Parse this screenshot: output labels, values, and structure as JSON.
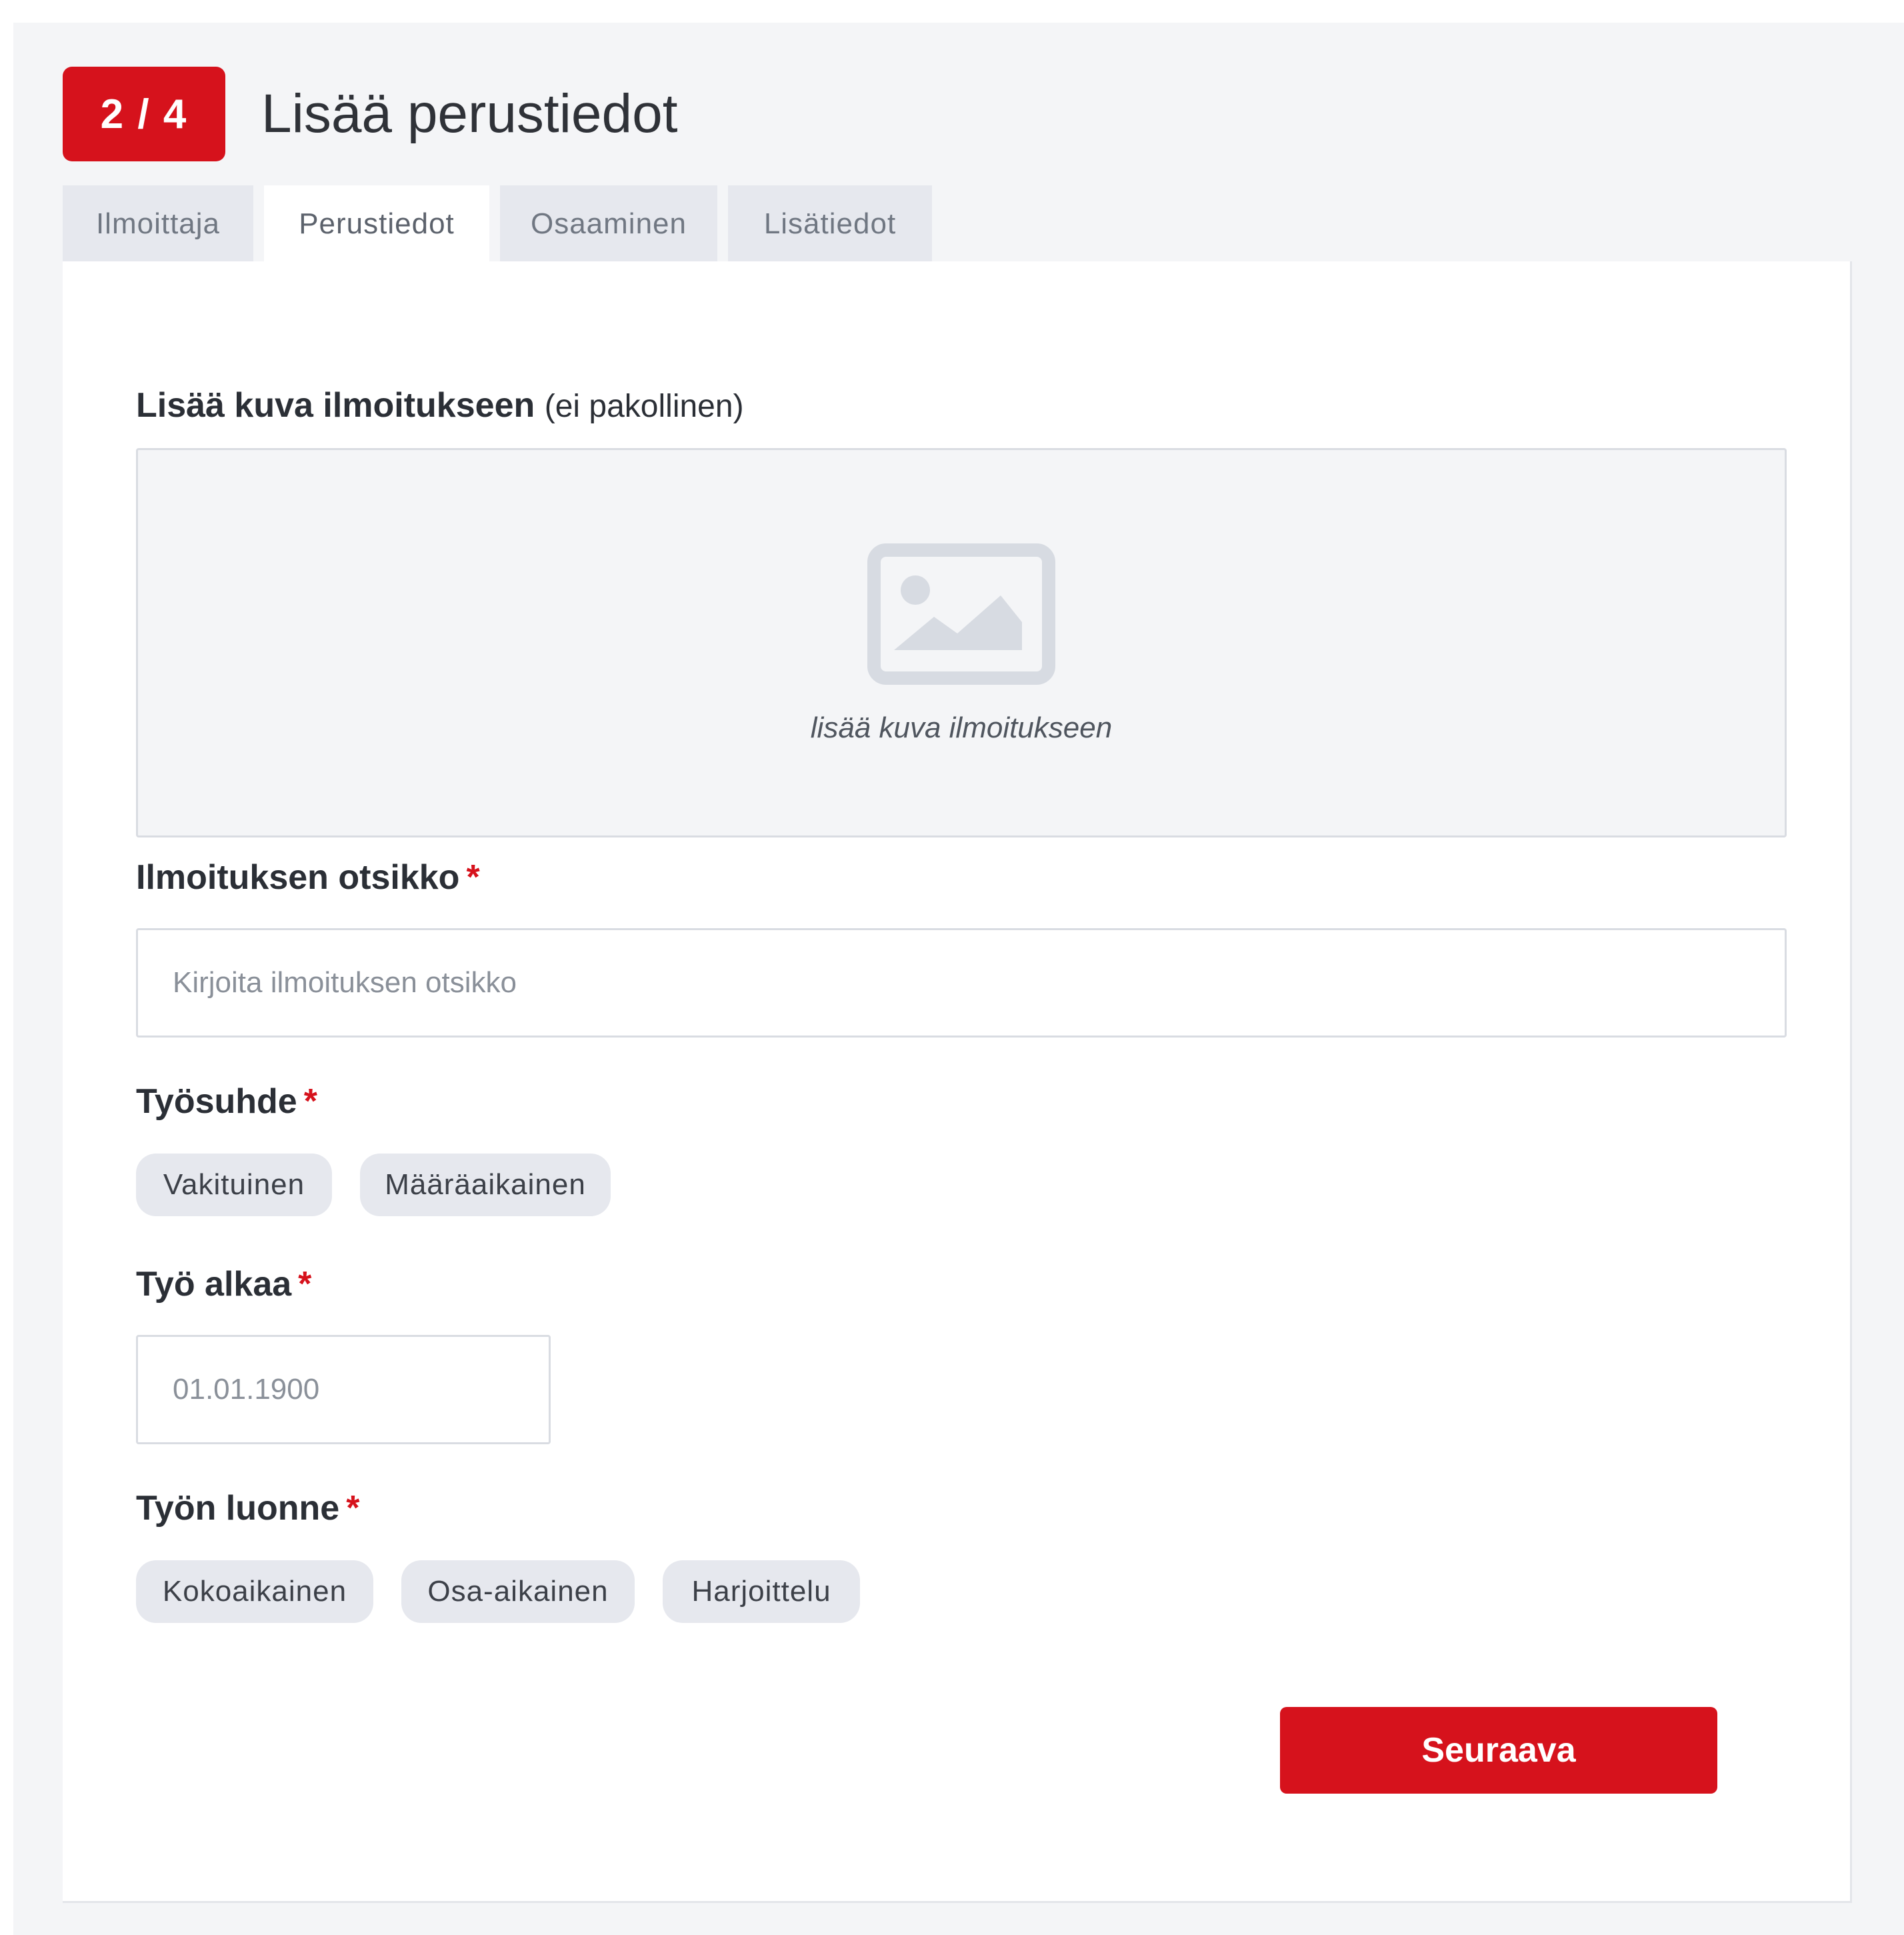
{
  "header": {
    "step": "2 / 4",
    "title": "Lisää perustiedot"
  },
  "tabs": [
    {
      "label": "Ilmoittaja",
      "active": false
    },
    {
      "label": "Perustiedot",
      "active": true
    },
    {
      "label": "Osaaminen",
      "active": false
    },
    {
      "label": "Lisätiedot",
      "active": false
    }
  ],
  "form": {
    "image": {
      "label": "Lisää kuva ilmoitukseen",
      "optional_note": "(ei pakollinen)",
      "upload_text": "lisää kuva ilmoitukseen",
      "icon": "image-placeholder-icon"
    },
    "title_field": {
      "label": "Ilmoituksen otsikko",
      "required_mark": "*",
      "placeholder": "Kirjoita ilmoituksen otsikko",
      "value": ""
    },
    "employment": {
      "label": "Työsuhde",
      "required_mark": "*",
      "options": [
        "Vakituinen",
        "Määräaikainen"
      ]
    },
    "start": {
      "label": "Työ alkaa",
      "required_mark": "*",
      "placeholder": "01.01.1900",
      "value": ""
    },
    "nature": {
      "label": "Työn luonne",
      "required_mark": "*",
      "options": [
        "Kokoaikainen",
        "Osa-aikainen",
        "Harjoittelu"
      ]
    },
    "next_label": "Seuraava"
  },
  "colors": {
    "accent": "#d6121c",
    "background": "#f4f5f7",
    "chip": "#e6e8ee"
  }
}
